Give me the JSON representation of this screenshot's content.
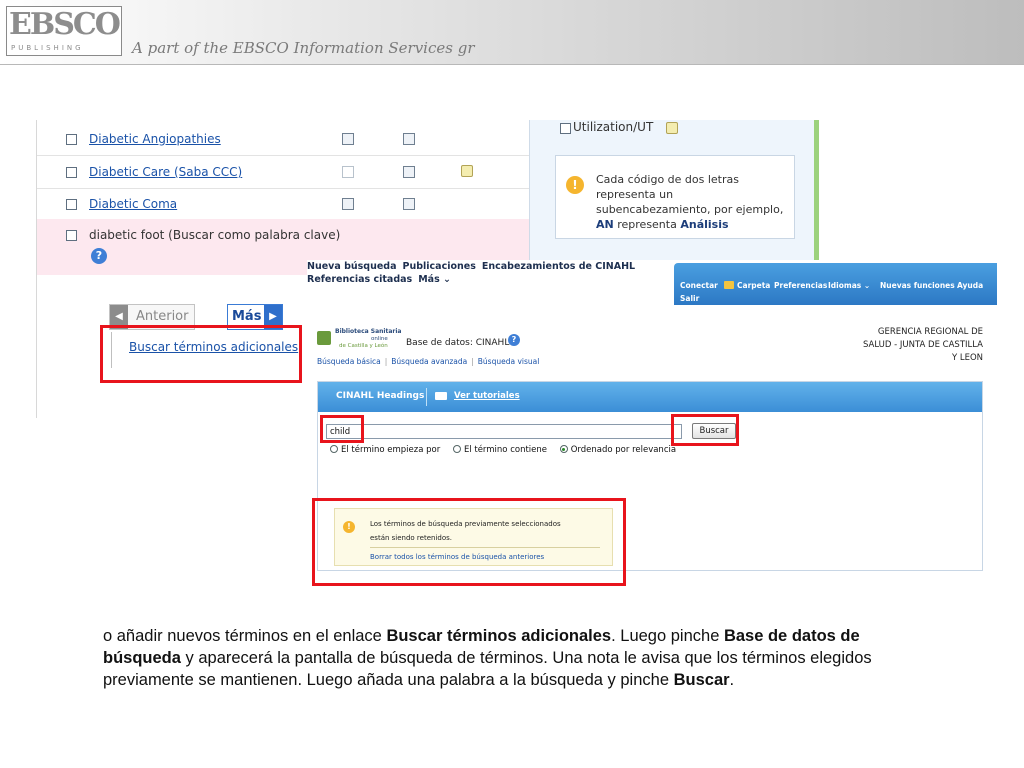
{
  "header": {
    "logo_main": "EBSCO",
    "logo_sub": "PUBLISHING",
    "tagline": "A part of the EBSCO Information Services gr"
  },
  "subject_list": {
    "rows": [
      {
        "label": "Diabetic Angiopathies"
      },
      {
        "label": "Diabetic Care (Saba CCC)"
      },
      {
        "label": "Diabetic Coma"
      }
    ],
    "keyword_row": "diabetic foot (Buscar como palabra clave)",
    "help_glyph": "?",
    "pager": {
      "prev": "Anterior",
      "next": "Más",
      "prev_arrow": "◀",
      "next_arrow": "▶"
    },
    "more_terms_link": "Buscar términos adicionales"
  },
  "side_panel": {
    "checkbox_label": "Utilization/UT",
    "info_icon": "!",
    "info_prefix": "Cada código de dos letras representa un subencabezamiento, por ejemplo,",
    "info_code": "AN",
    "info_middle": "representa",
    "info_term": "Análisis"
  },
  "cinahl": {
    "topnav": [
      "Nueva búsqueda",
      "Publicaciones",
      "Encabezamientos de CINAHL",
      "Referencias citadas",
      "Más ⌄"
    ],
    "toolbar": {
      "conectar": "Conectar",
      "carpeta": "Carpeta",
      "preferencias": "Preferencias",
      "idiomas": "Idiomas ⌄",
      "nuevas": "Nuevas funciones",
      "ayuda": "Ayuda",
      "salir": "Salir"
    },
    "brand": {
      "line1": "Biblioteca Sanitaria",
      "line2": "online",
      "line3": "de Castilla y León"
    },
    "db_label": "Base de datos: CINAHL",
    "db_help": "?",
    "org_lines": [
      "GERENCIA REGIONAL DE",
      "SALUD - JUNTA DE CASTILLA",
      "Y LEON"
    ],
    "search_modes": [
      "Búsqueda básica",
      "Búsqueda avanzada",
      "Búsqueda visual"
    ],
    "panel_title": "CINAHL Headings",
    "tutorials_link": "Ver tutoriales",
    "search_value": "child",
    "search_button": "Buscar",
    "radio_options": [
      {
        "label": "El término empieza por",
        "selected": false
      },
      {
        "label": "El término contiene",
        "selected": false
      },
      {
        "label": "Ordenado por relevancia",
        "selected": true
      }
    ],
    "notice": {
      "icon": "!",
      "text_line1": "Los términos de búsqueda previamente seleccionados",
      "text_line2": "están siendo retenidos.",
      "link": "Borrar todos los términos de búsqueda anteriores"
    }
  },
  "caption": {
    "part1": "o añadir nuevos términos en el enlace ",
    "bold1": "Buscar términos adicionales",
    "part2": ". Luego pinche ",
    "bold2": "Base de datos de búsqueda",
    "part3": " y aparecerá la pantalla de búsqueda de términos. Una nota le avisa que los términos elegidos previamente se mantienen. Luego añada una palabra a la búsqueda y pinche ",
    "bold3": "Buscar",
    "part4": "."
  },
  "colors": {
    "highlight_box": "#e8141c",
    "link": "#1a52a8",
    "toolbar": "#2c78c4"
  }
}
